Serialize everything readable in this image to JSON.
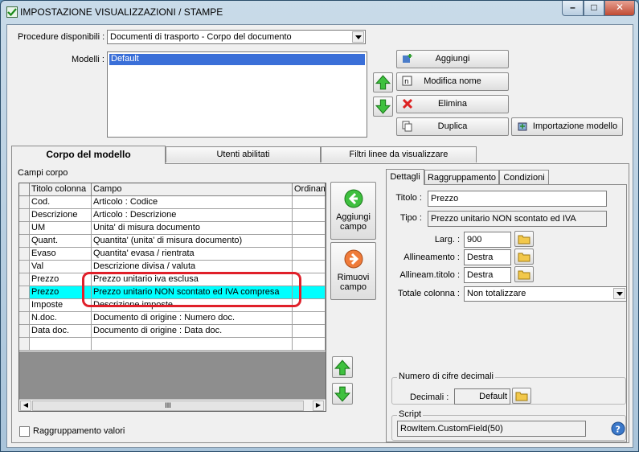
{
  "window": {
    "title": "IMPOSTAZIONE VISUALIZZAZIONI / STAMPE"
  },
  "top": {
    "procedure_label": "Procedure disponibili :",
    "procedure_value": "Documenti di trasporto - Corpo del documento",
    "modelli_label": "Modelli :",
    "modelli_items": [
      "Default"
    ],
    "buttons": {
      "aggiungi": "Aggiungi",
      "modifica_nome": "Modifica nome",
      "elimina": "Elimina",
      "duplica": "Duplica",
      "importazione": "Importazione modello"
    }
  },
  "tabs": [
    "Corpo del modello",
    "Utenti abilitati",
    "Filtri linee da visualizzare"
  ],
  "corpo": {
    "group_label": "Campi corpo",
    "columns": [
      "Titolo colonna",
      "Campo",
      "Ordinam"
    ],
    "rows": [
      [
        "Cod.",
        "Articolo : Codice"
      ],
      [
        "Descrizione",
        "Articolo : Descrizione"
      ],
      [
        "UM",
        "Unita' di misura documento"
      ],
      [
        "Quant.",
        "Quantita' (unita' di misura documento)"
      ],
      [
        "Evaso",
        "Quantita' evasa / rientrata"
      ],
      [
        "Val",
        "Descrizione divisa / valuta"
      ],
      [
        "Prezzo",
        "Prezzo unitario iva esclusa"
      ],
      [
        "Prezzo",
        "Prezzo unitario NON scontato ed IVA compresa"
      ],
      [
        "Imposte",
        "Descrizione imposte"
      ],
      [
        "N.doc.",
        "Documento di origine : Numero doc."
      ],
      [
        "Data doc.",
        "Documento di origine : Data doc."
      ]
    ],
    "selected_row_index": 7,
    "aggiungi_campo": [
      "Aggiungi",
      "campo"
    ],
    "rimuovi_campo": [
      "Rimuovi",
      "campo"
    ],
    "scroll_mark": "III",
    "raggruppamento_valori": "Raggruppamento valori"
  },
  "details": {
    "tabs": [
      "Dettagli",
      "Raggruppamento",
      "Condizioni"
    ],
    "titolo_label": "Titolo :",
    "titolo_value": "Prezzo",
    "tipo_label": "Tipo :",
    "tipo_value": "Prezzo unitario NON scontato ed IVA",
    "larg_label": "Larg. :",
    "larg_value": "900",
    "allineamento_label": "Allineamento :",
    "allineamento_value": "Destra",
    "allineam_titolo_label": "Allineam.titolo :",
    "allineam_titolo_value": "Destra",
    "totale_label": "Totale colonna :",
    "totale_value": "Non totalizzare",
    "cifre_group": "Numero di cifre decimali",
    "decimali_label": "Decimali :",
    "decimali_value": "Default",
    "script_group": "Script",
    "script_value": "RowItem.CustomField(50)"
  },
  "colors": {
    "highlight_row": "#00ffff",
    "annotation": "#e0202a",
    "selection": "#3a6fd8"
  }
}
